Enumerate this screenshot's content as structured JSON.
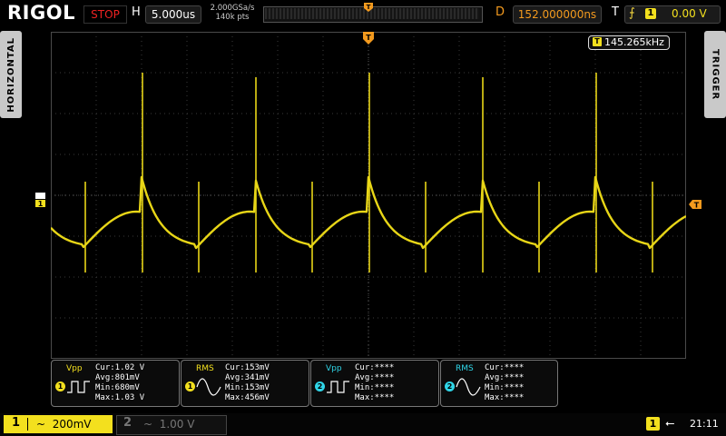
{
  "brand": "RIGOL",
  "status": "STOP",
  "horizontal": {
    "label": "H",
    "timebase": "5.000us"
  },
  "sample": {
    "rate": "2.000GSa/s",
    "points": "140k pts"
  },
  "delay": {
    "label": "D",
    "value": "152.000000ns"
  },
  "trigger": {
    "label": "T",
    "edge_symbol": "⨍",
    "channel": "1",
    "level": "0.00 V"
  },
  "side_tabs": {
    "left": "HORIZONTAL",
    "right": "TRIGGER"
  },
  "frequency": {
    "channel": "T",
    "value": "145.265kHz"
  },
  "channel_marker": "1",
  "trigger_marker": "T",
  "measurements": [
    {
      "badge": "1",
      "name": "Vpp",
      "color": "#f3e01e",
      "wave": "square",
      "cur": "Cur:1.02 V",
      "avg": "Avg:801mV",
      "min": "Min:680mV",
      "max": "Max:1.03 V"
    },
    {
      "badge": "1",
      "name": "RMS",
      "color": "#f3e01e",
      "wave": "sine",
      "cur": "Cur:153mV",
      "avg": "Avg:341mV",
      "min": "Min:153mV",
      "max": "Max:456mV"
    },
    {
      "badge": "2",
      "name": "Vpp",
      "color": "#2fd6e8",
      "wave": "square",
      "cur": "Cur:****",
      "avg": "Avg:****",
      "min": "Min:****",
      "max": "Max:****"
    },
    {
      "badge": "2",
      "name": "RMS",
      "color": "#2fd6e8",
      "wave": "sine",
      "cur": "Cur:****",
      "avg": "Avg:****",
      "min": "Min:****",
      "max": "Max:****"
    }
  ],
  "channels": [
    {
      "number": "1",
      "coupling": "~",
      "scale": "200mV"
    },
    {
      "number": "2",
      "coupling": "~",
      "scale": "1.00 V"
    }
  ],
  "status_bar": {
    "channel": "1",
    "clock": "21:11"
  },
  "colors": {
    "ch1": "#f3e01e",
    "ch2": "#2fd6e8",
    "delay": "#f39a1e",
    "stop": "#e22"
  }
}
